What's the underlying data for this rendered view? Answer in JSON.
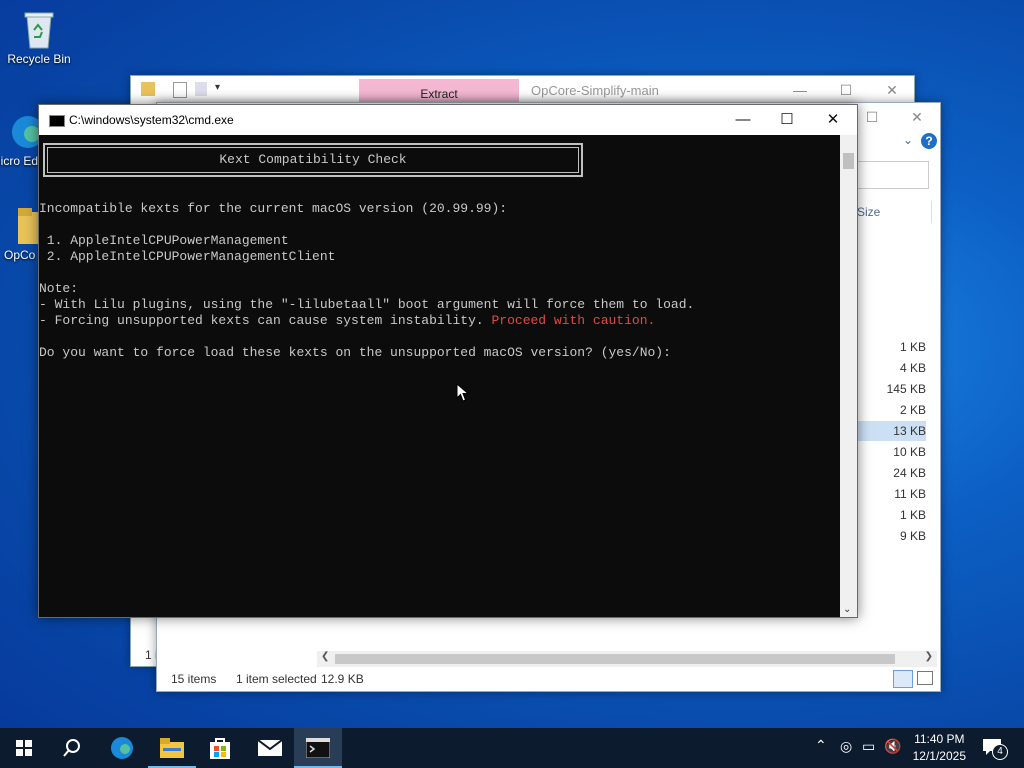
{
  "desktop": {
    "icons": [
      {
        "label": "Recycle Bin"
      },
      {
        "label": "Micro Ed"
      },
      {
        "label": "OpCo"
      }
    ]
  },
  "back_window": {
    "ribbon_tab": "Extract",
    "title": "OpCore-Simplify-main",
    "status_fragment": "1 i"
  },
  "explorer": {
    "size_header": "Size",
    "sizes": [
      "1 KB",
      "4 KB",
      "145 KB",
      "2 KB",
      "13 KB",
      "10 KB",
      "24 KB",
      "11 KB",
      "1 KB",
      "9 KB"
    ],
    "selected_index": 4,
    "status": {
      "items": "15 items",
      "selected": "1 item selected",
      "selected_size": "12.9 KB"
    }
  },
  "cmd": {
    "title": "C:\\windows\\system32\\cmd.exe",
    "banner": "Kext Compatibility Check",
    "lines": {
      "incompatible": "Incompatible kexts for the current macOS version (20.99.99):",
      "kext1": " 1. AppleIntelCPUPowerManagement",
      "kext2": " 2. AppleIntelCPUPowerManagementClient",
      "note": "Note:",
      "note1": "- With Lilu plugins, using the \"-lilubetaall\" boot argument will force them to load.",
      "note2_a": "- Forcing unsupported kexts can cause system instability. ",
      "note2_b": "Proceed with caution.",
      "prompt": "Do you want to force load these kexts on the unsupported macOS version? (yes/No):"
    },
    "colors": {
      "warning": "#e04848",
      "text": "#c8c8c8",
      "background": "#0c0c0c"
    }
  },
  "taskbar": {
    "time": "11:40 PM",
    "date": "12/1/2025",
    "notification_count": "4",
    "apps": [
      "start-icon",
      "search-icon",
      "edge-icon",
      "file-explorer-icon",
      "store-icon",
      "mail-icon",
      "cmd-icon"
    ]
  }
}
